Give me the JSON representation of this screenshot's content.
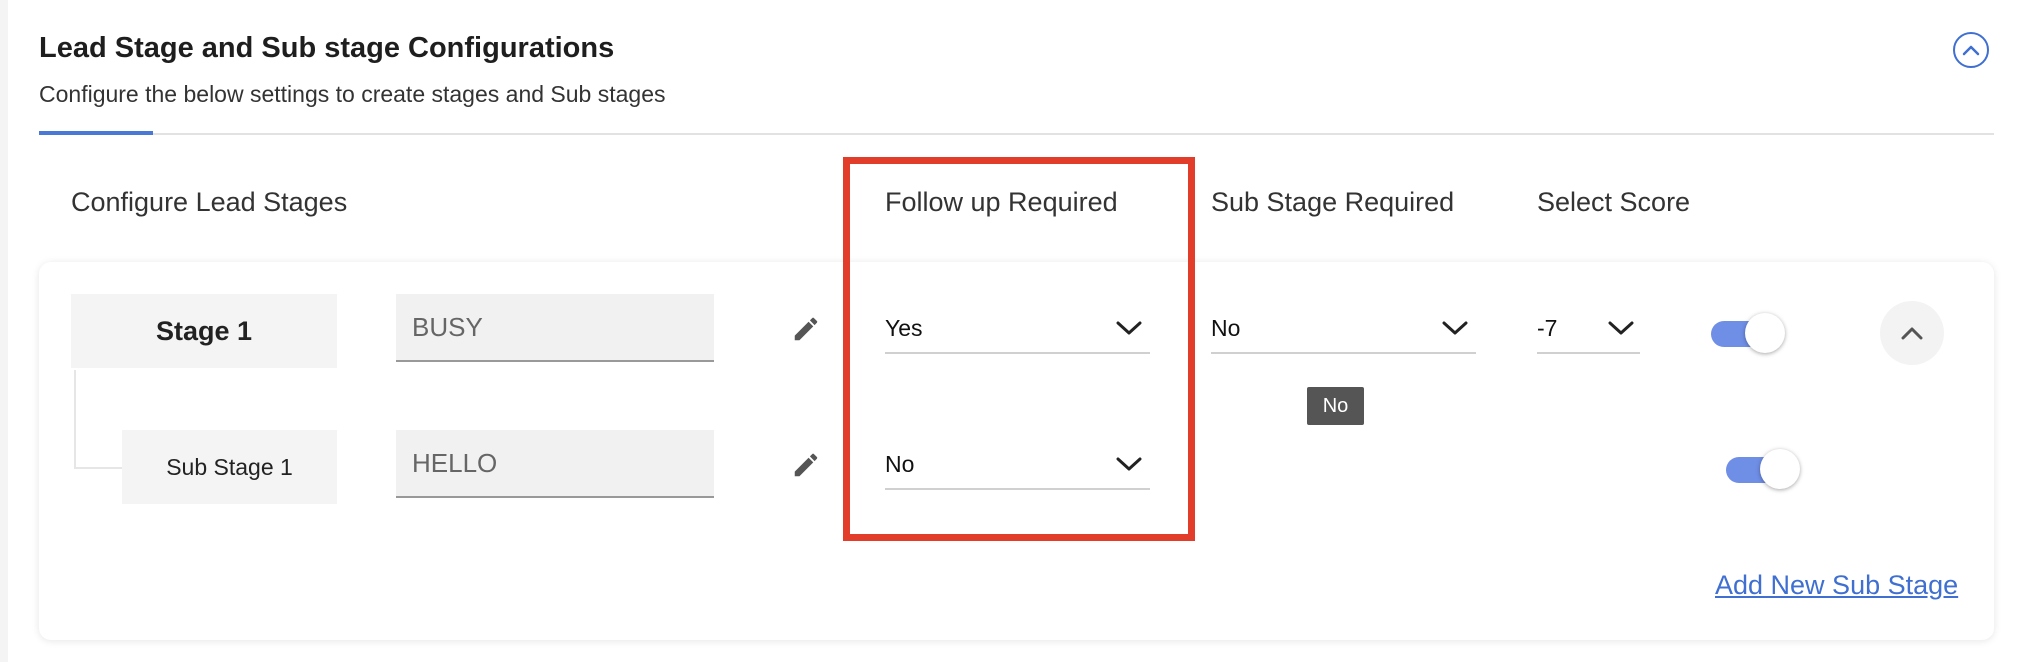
{
  "header": {
    "title": "Lead Stage and Sub stage Configurations",
    "subtitle": "Configure the below settings to create stages and Sub stages"
  },
  "columns": {
    "configure": "Configure Lead Stages",
    "follow_up": "Follow up Required",
    "sub_stage": "Sub Stage Required",
    "score": "Select Score"
  },
  "stage": {
    "label": "Stage 1",
    "name_value": "BUSY",
    "follow_up_value": "Yes",
    "sub_stage_required_value": "No",
    "score_value": "-7",
    "enabled": true
  },
  "sub_stage": {
    "label": "Sub Stage 1",
    "name_value": "HELLO",
    "follow_up_value": "No",
    "enabled": true
  },
  "tooltip": {
    "text": "No"
  },
  "add_sub_stage_label": "Add New Sub Stage",
  "icons": {
    "collapse": "chevron-up-circle-icon",
    "edit": "pencil-icon",
    "dropdown": "chevron-down-icon",
    "expand": "chevron-up-icon"
  },
  "colors": {
    "accent": "#3f6fd1",
    "toggle_track": "#6f8ee6",
    "highlight": "#e23d2a"
  }
}
